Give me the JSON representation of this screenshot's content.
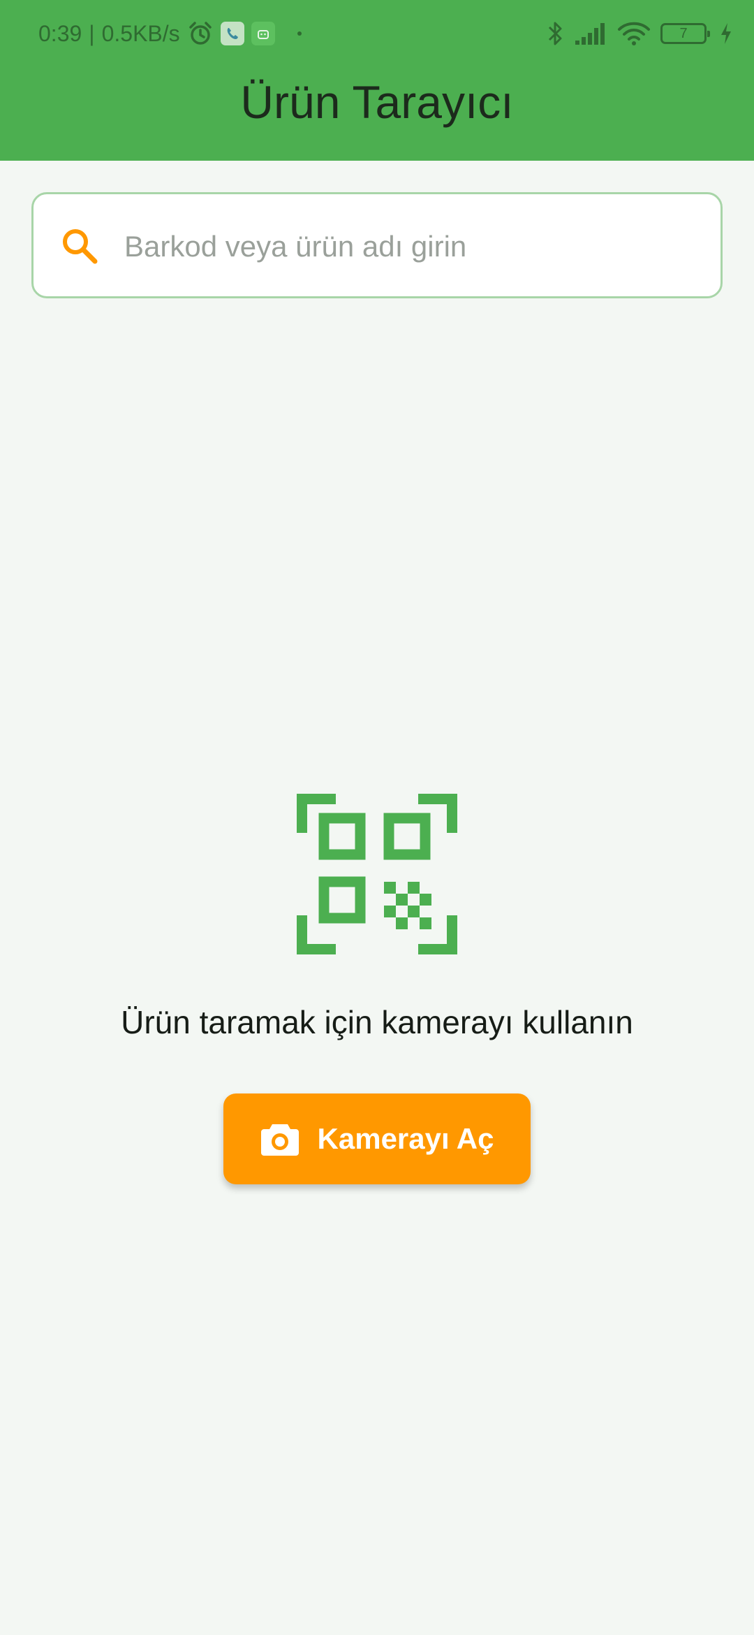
{
  "status_bar": {
    "time": "0:39",
    "separator": "|",
    "speed": "0.5KB/s",
    "battery_level": "7",
    "icons": [
      "alarm-icon",
      "phone-app-icon",
      "android-app-icon",
      "notification-dot",
      "bluetooth-icon",
      "signal-icon",
      "wifi-icon",
      "battery-icon",
      "charging-icon"
    ]
  },
  "header": {
    "title": "Ürün Tarayıcı",
    "color": "#4caf50"
  },
  "search": {
    "placeholder": "Barkod veya ürün adı girin",
    "value": "",
    "icon": "search-icon",
    "icon_color": "#ff9800",
    "border_color": "#a8d5a8"
  },
  "empty_state": {
    "icon": "qr-scan-icon",
    "icon_color": "#4caf50",
    "message": "Ürün taramak için kamerayı kullanın"
  },
  "camera_button": {
    "label": "Kamerayı Aç",
    "icon": "camera-icon",
    "color": "#ff9800"
  }
}
